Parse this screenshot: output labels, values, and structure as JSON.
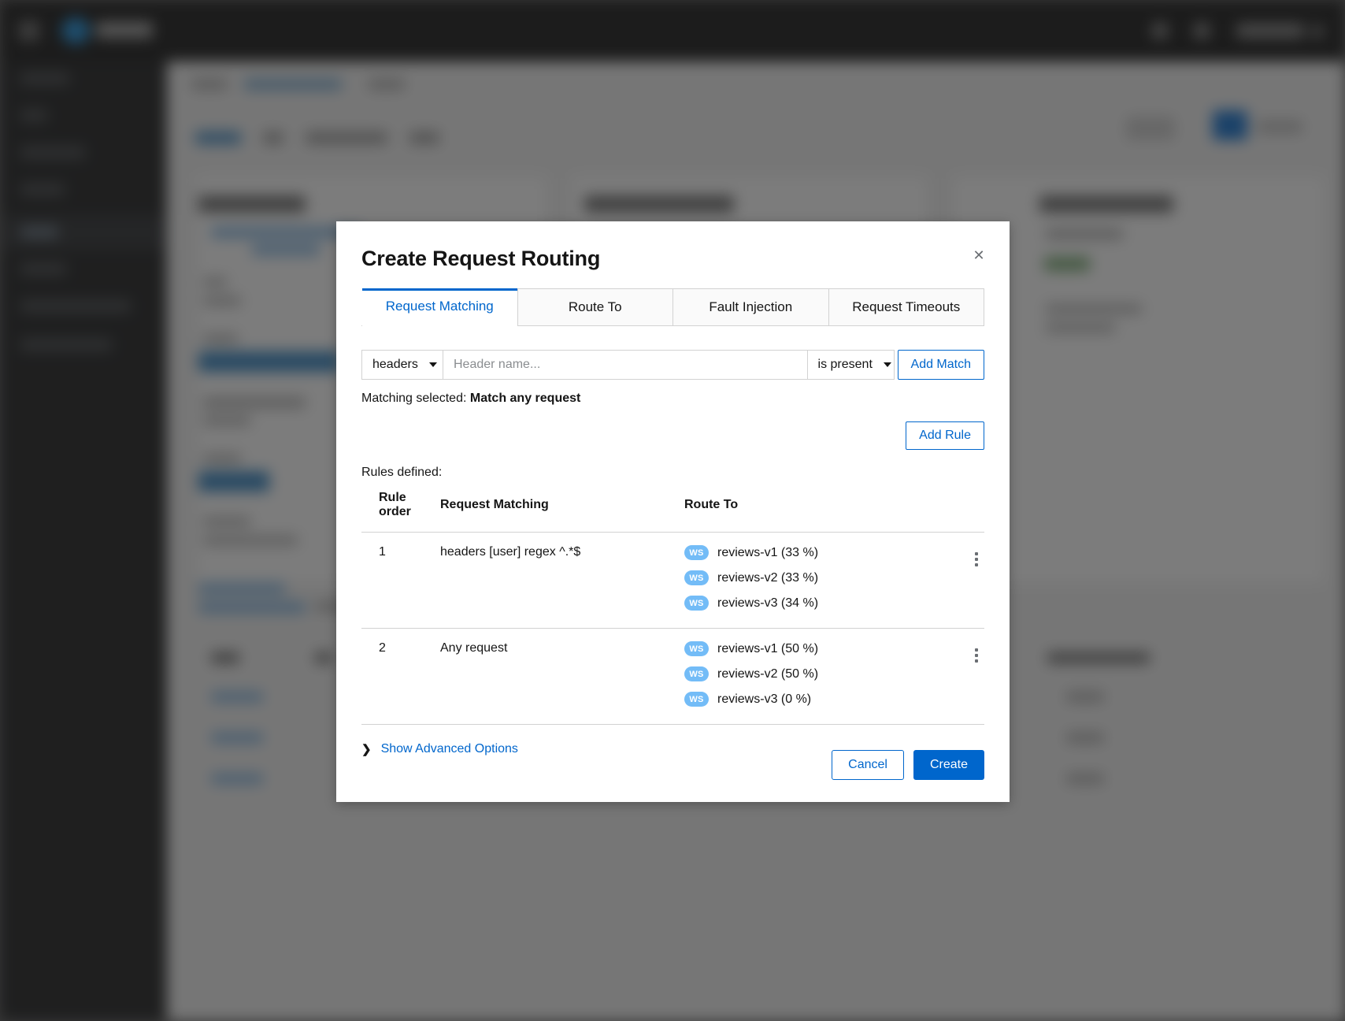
{
  "modal": {
    "title": "Create Request Routing",
    "close_icon": "close-icon",
    "tabs": [
      {
        "label": "Request Matching",
        "active": true
      },
      {
        "label": "Route To",
        "active": false
      },
      {
        "label": "Fault Injection",
        "active": false
      },
      {
        "label": "Request Timeouts",
        "active": false
      }
    ],
    "match_builder": {
      "category_value": "headers",
      "header_name_placeholder": "Header name...",
      "header_name_value": "",
      "operator_value": "is present",
      "add_match_label": "Add Match"
    },
    "matching_selected_label": "Matching selected:",
    "matching_selected_value": "Match any request",
    "add_rule_label": "Add Rule",
    "rules_defined_label": "Rules defined:",
    "table": {
      "headers": [
        "Rule order",
        "Request Matching",
        "Route To",
        ""
      ],
      "rows": [
        {
          "order": "1",
          "matching": "headers [user] regex ^.*$",
          "routes": [
            {
              "badge": "WS",
              "label": "reviews-v1 (33 %)"
            },
            {
              "badge": "WS",
              "label": "reviews-v2 (33 %)"
            },
            {
              "badge": "WS",
              "label": "reviews-v3 (34 %)"
            }
          ]
        },
        {
          "order": "2",
          "matching": "Any request",
          "routes": [
            {
              "badge": "WS",
              "label": "reviews-v1 (50 %)"
            },
            {
              "badge": "WS",
              "label": "reviews-v2 (50 %)"
            },
            {
              "badge": "WS",
              "label": "reviews-v3 (0 %)"
            }
          ]
        }
      ]
    },
    "advanced": {
      "chevron": "❯",
      "label": "Show Advanced Options"
    },
    "footer": {
      "cancel_label": "Cancel",
      "create_label": "Create"
    }
  },
  "colors": {
    "accent_blue": "#0066cc",
    "badge_blue": "#73bcf7",
    "text": "#151515",
    "border": "#d2d2d2",
    "scrim": "rgba(44,44,44,0.62)"
  }
}
